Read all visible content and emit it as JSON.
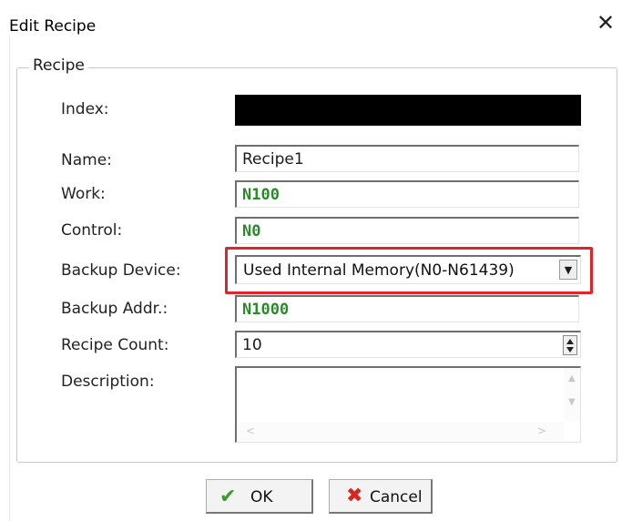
{
  "window": {
    "title": "Edit Recipe",
    "close_icon": "close-icon"
  },
  "group": {
    "legend": "Recipe"
  },
  "fields": {
    "index": {
      "label": "Index:",
      "value": ""
    },
    "name": {
      "label": "Name:",
      "value": "Recipe1"
    },
    "work": {
      "label": "Work:",
      "value": "N100"
    },
    "control": {
      "label": "Control:",
      "value": "N0"
    },
    "backup_device": {
      "label": "Backup Device:",
      "value": "Used Internal Memory(N0-N61439)"
    },
    "backup_addr": {
      "label": "Backup Addr.:",
      "value": "N1000"
    },
    "recipe_count": {
      "label": "Recipe Count:",
      "value": "10"
    },
    "description": {
      "label": "Description:",
      "value": ""
    }
  },
  "buttons": {
    "ok_label": "OK",
    "cancel_label": "Cancel"
  },
  "colors": {
    "highlight": "#e1232c",
    "address_text": "#2a8a2a",
    "ok_icon": "#3a9a2a",
    "cancel_icon": "#d8251f"
  }
}
